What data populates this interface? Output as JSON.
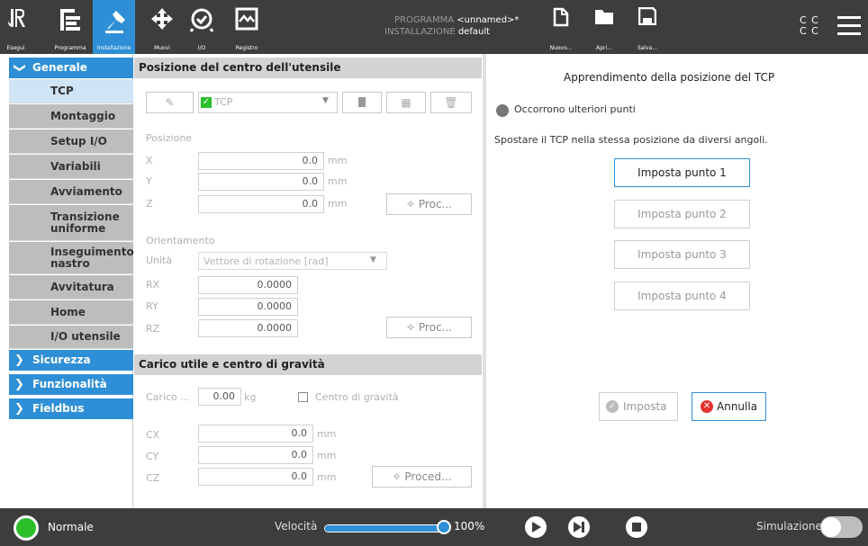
{
  "header": {
    "nav": [
      {
        "label": "Esegui",
        "icon": "ur-logo-icon"
      },
      {
        "label": "Programma",
        "icon": "program-icon"
      },
      {
        "label": "Installazione",
        "icon": "installation-icon"
      },
      {
        "label": "Muovi",
        "icon": "move-icon"
      },
      {
        "label": "I/O",
        "icon": "io-icon"
      },
      {
        "label": "Registro",
        "icon": "log-icon"
      }
    ],
    "program_label": "PROGRAMMA",
    "program_value": "<unnamed>*",
    "installation_label": "INSTALLAZIONE",
    "installation_value": "default",
    "actions": [
      {
        "label": "Nuovo...",
        "icon": "new-file-icon"
      },
      {
        "label": "Apri...",
        "icon": "folder-icon"
      },
      {
        "label": "Salva...",
        "icon": "save-icon"
      }
    ],
    "cc_top": "C C",
    "cc_bottom": "C C"
  },
  "sidebar": {
    "generale": "Generale",
    "items": [
      "TCP",
      "Montaggio",
      "Setup I/O",
      "Variabili",
      "Avviamento",
      "Transizione uniforme",
      "Inseguimento nastro",
      "Avvitatura",
      "Home",
      "I/O utensile"
    ],
    "sections": [
      "Sicurezza",
      "Funzionalità",
      "Fieldbus"
    ]
  },
  "tcp_panel": {
    "title": "Posizione del centro dell'utensile",
    "tcp_select": "TCP",
    "position_label": "Posizione",
    "x_label": "X",
    "y_label": "Y",
    "z_label": "Z",
    "x": "0.0",
    "y": "0.0",
    "z": "0.0",
    "unit_mm": "mm",
    "proc_button": "Proc...",
    "orientation_label": "Orientamento",
    "units_label": "Unità",
    "units_value": "Vettore di rotazione [rad]",
    "rx_label": "RX",
    "ry_label": "RY",
    "rz_label": "RZ",
    "rx": "0.0000",
    "ry": "0.0000",
    "rz": "0.0000",
    "proc_button2": "Proc..."
  },
  "payload_panel": {
    "title": "Carico utile e centro di gravità",
    "payload_label": "Carico ...",
    "payload_value": "0.00",
    "payload_unit": "kg",
    "cog_label": "Centro di gravità",
    "cx_label": "CX",
    "cy_label": "CY",
    "cz_label": "CZ",
    "cx": "0.0",
    "cy": "0.0",
    "cz": "0.0",
    "unit_mm": "mm",
    "proc_button": "Proced..."
  },
  "teach_panel": {
    "title": "Apprendimento della posizione del TCP",
    "status": "Occorrono ulteriori punti",
    "instruction": "Spostare il TCP nella stessa posizione da diversi angoli.",
    "points": [
      "Imposta punto 1",
      "Imposta punto 2",
      "Imposta punto 3",
      "Imposta punto 4"
    ],
    "set_button": "Imposta",
    "cancel_button": "Annulla"
  },
  "footer": {
    "mode": "Normale",
    "speed_label": "Velocità",
    "speed_value": "100%",
    "speed_fraction": 1.0,
    "simulation_label": "Simulazione"
  },
  "colors": {
    "accent": "#2f8fd6",
    "dark": "#3d3d3d",
    "status_ok": "#2cbf2c",
    "cancel": "#e5322d"
  }
}
